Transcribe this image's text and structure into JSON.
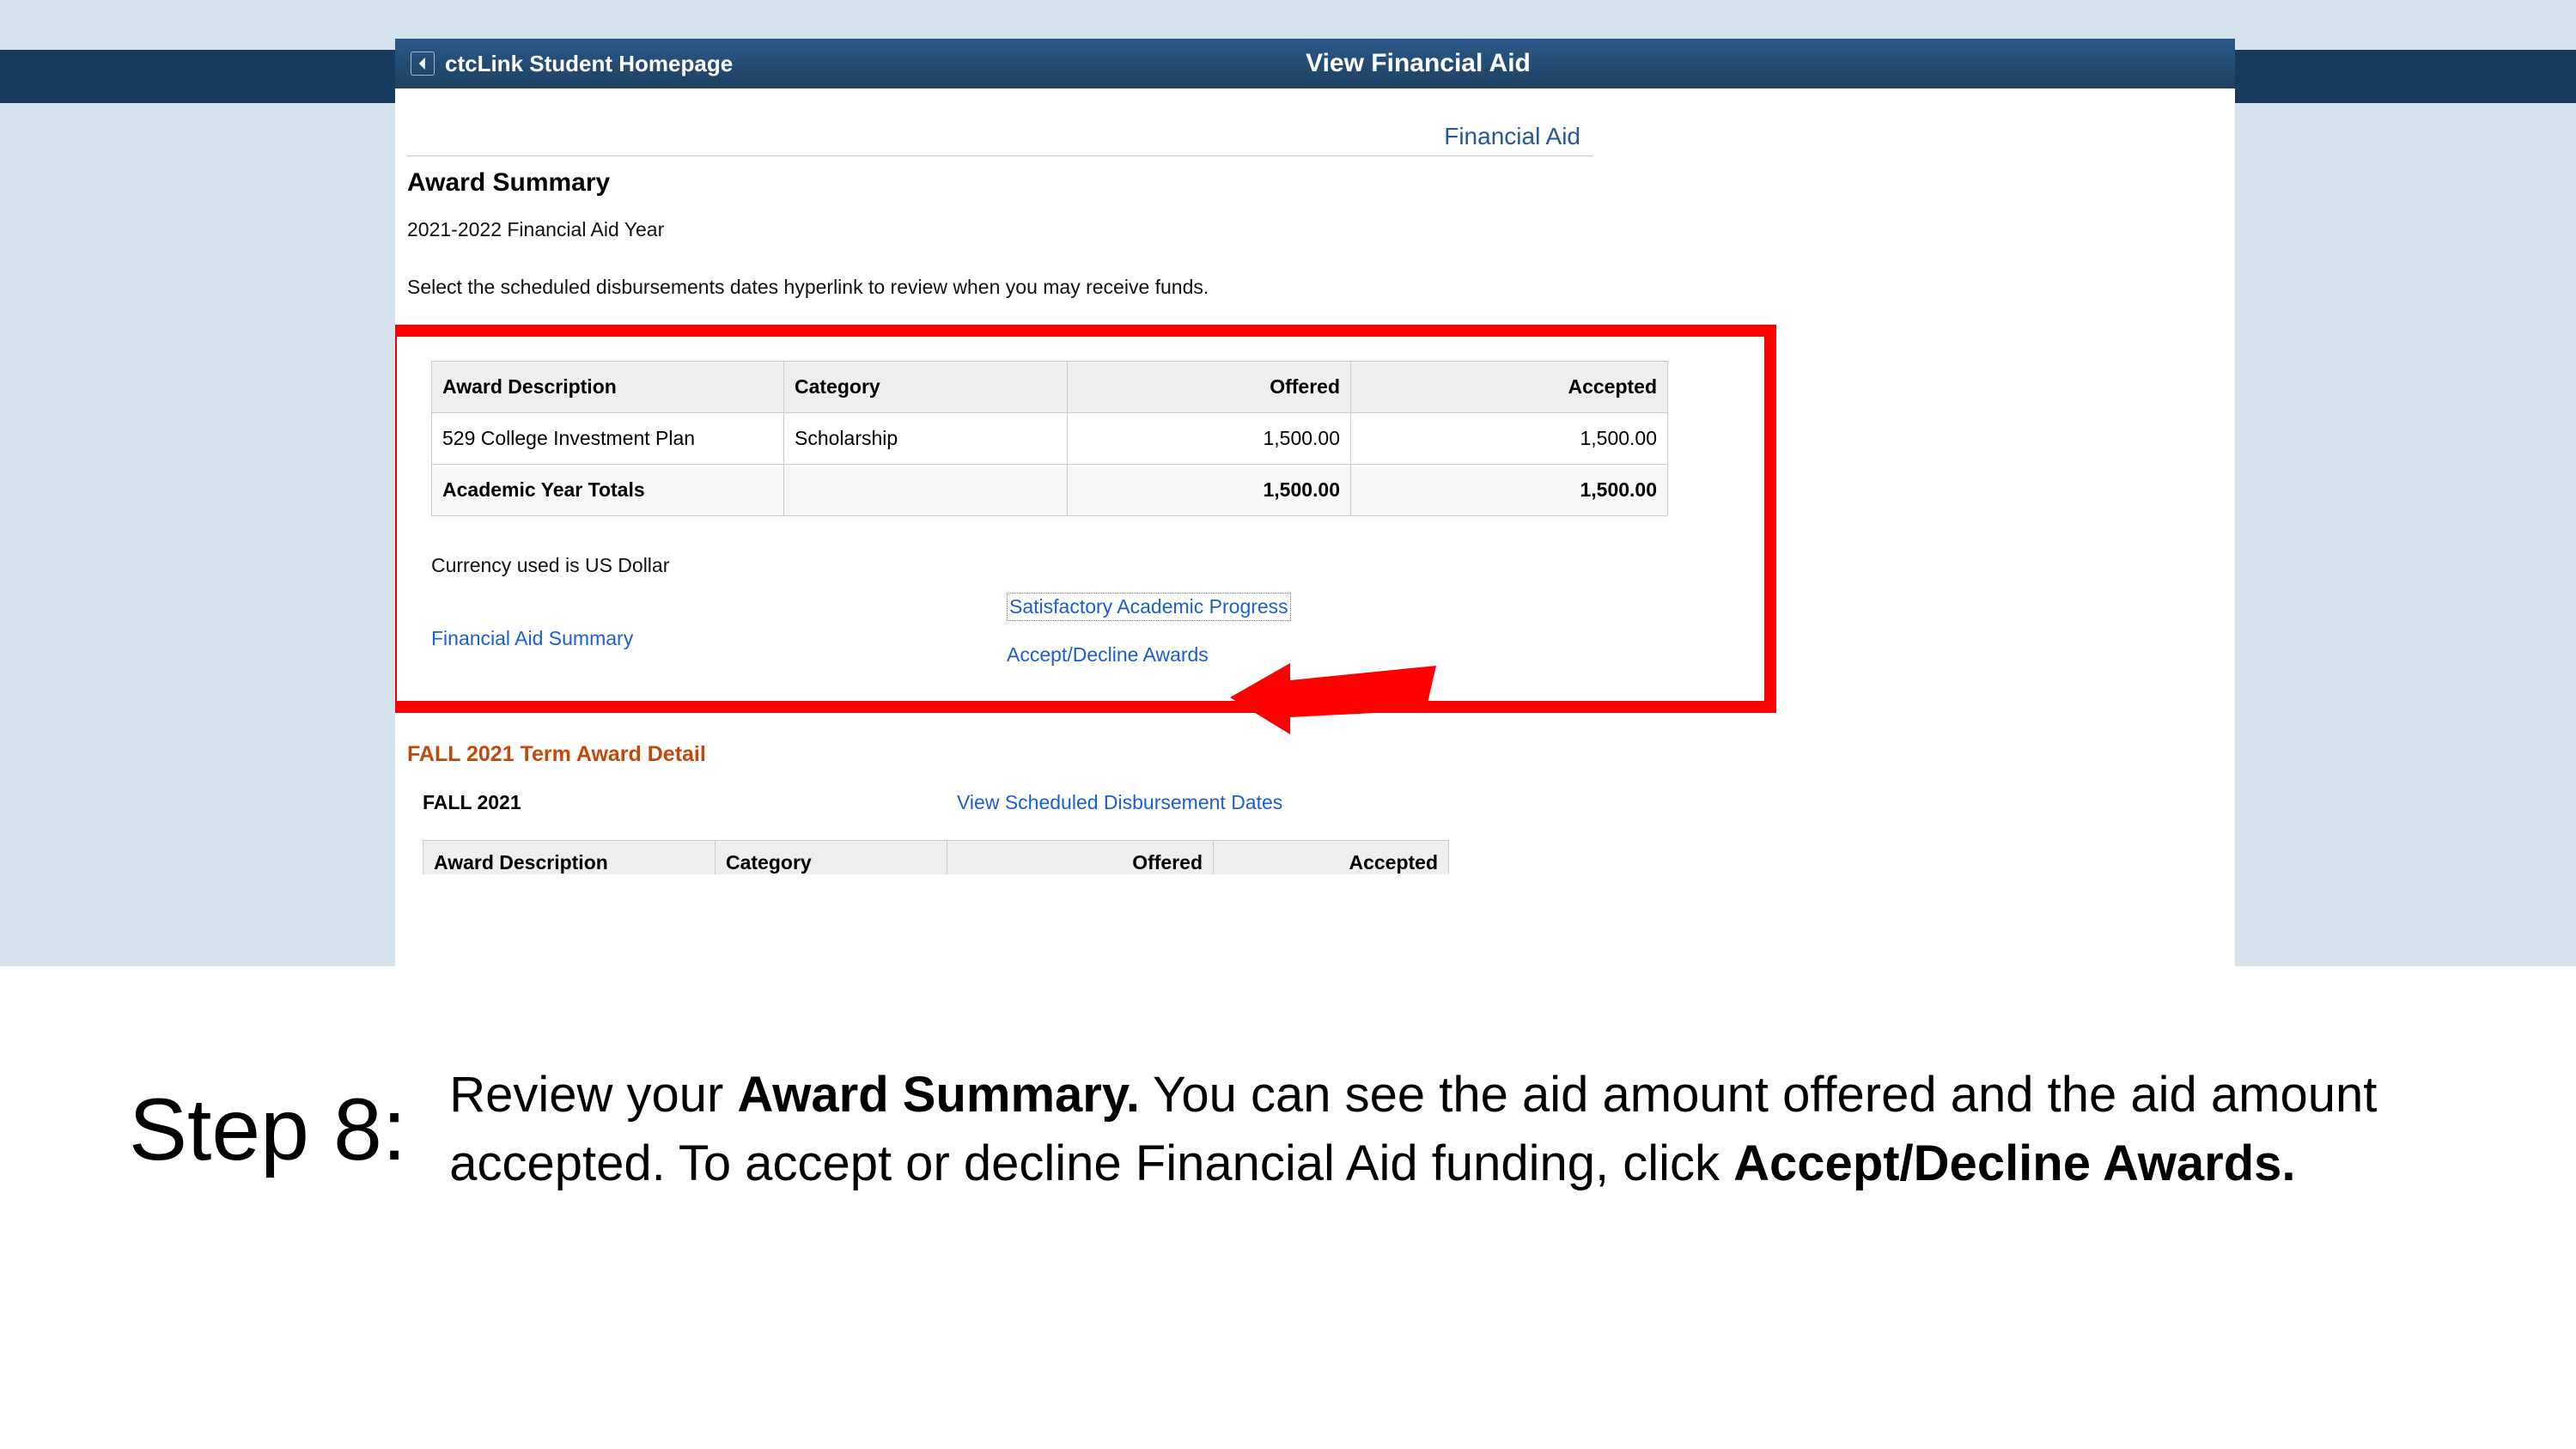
{
  "header": {
    "back_label": "ctcLink Student Homepage",
    "title": "View Financial Aid"
  },
  "page": {
    "top_link": "Financial Aid",
    "section_title": "Award Summary",
    "aid_year": "2021-2022 Financial Aid Year",
    "instruction": "Select the scheduled disbursements dates hyperlink to review when you may receive funds."
  },
  "award_table": {
    "headers": {
      "desc": "Award Description",
      "category": "Category",
      "offered": "Offered",
      "accepted": "Accepted"
    },
    "row": {
      "desc": "529 College Investment Plan",
      "category": "Scholarship",
      "offered": "1,500.00",
      "accepted": "1,500.00"
    },
    "totals": {
      "label": "Academic Year Totals",
      "offered": "1,500.00",
      "accepted": "1,500.00"
    }
  },
  "notes": {
    "currency": "Currency used is US Dollar"
  },
  "links": {
    "fa_summary": "Financial Aid Summary",
    "sap": "Satisfactory Academic Progress",
    "accept_decline": "Accept/Decline Awards"
  },
  "term": {
    "heading": "FALL 2021 Term Award Detail",
    "label": "FALL 2021",
    "disb_link": "View Scheduled Disbursement Dates"
  },
  "detail_table": {
    "headers": {
      "desc": "Award Description",
      "category": "Category",
      "offered": "Offered",
      "accepted": "Accepted"
    }
  },
  "tutorial": {
    "step_label": "Step 8:",
    "text_pre": "Review your ",
    "bold1": "Award Summary.",
    "text_mid": " You can see the aid amount offered and the aid amount accepted. To accept or decline Financial Aid funding, click ",
    "bold2": "Accept/Decline Awards."
  }
}
